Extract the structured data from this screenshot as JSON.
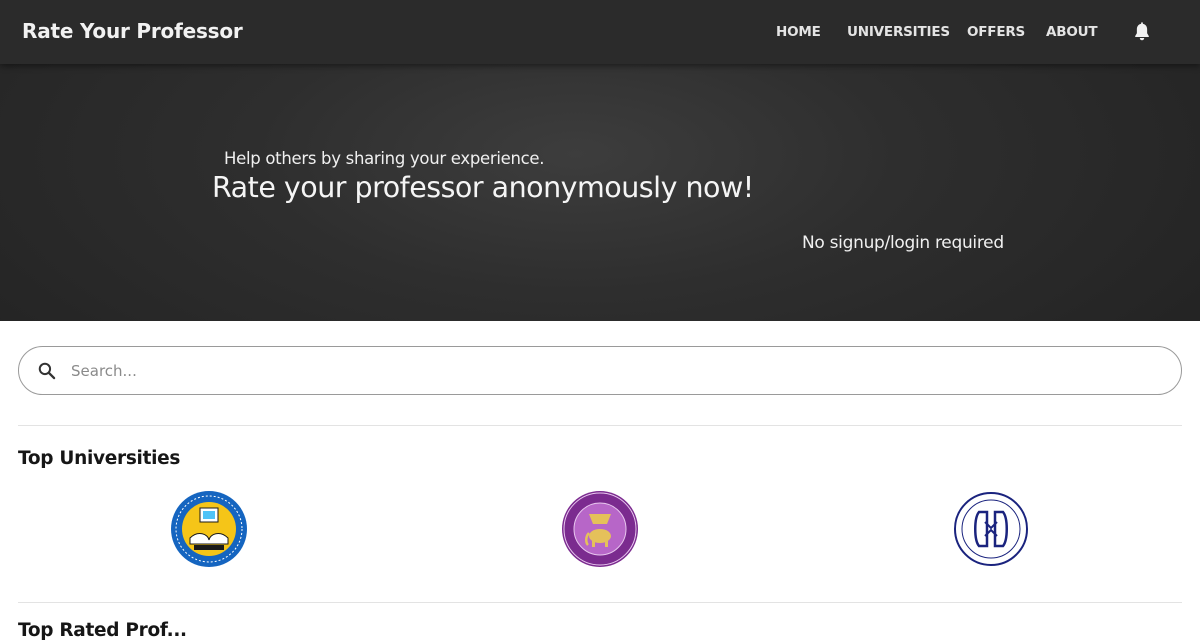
{
  "navbar": {
    "brand": "Rate Your Professor",
    "links": [
      {
        "label": "HOME"
      },
      {
        "label": "UNIVERSITIES"
      },
      {
        "label": "OFFERS"
      },
      {
        "label": "ABOUT"
      }
    ],
    "icons": {
      "notifications": "bell-icon"
    }
  },
  "hero": {
    "subtitle": "Help others by sharing your experience.",
    "title": "Rate your professor anonymously now!",
    "note": "No signup/login required"
  },
  "search": {
    "placeholder": "Search...",
    "value": "",
    "icon": "search-icon"
  },
  "top_universities": {
    "heading": "Top Universities",
    "logos": [
      {
        "icon": "university-seal-1",
        "ring": "#1565c0",
        "inner": "#f5c518"
      },
      {
        "icon": "university-seal-2",
        "ring": "#7b2b8f",
        "inner": "#b766c8"
      },
      {
        "icon": "university-seal-3",
        "ring": "#1a237e",
        "inner": "#ffffff"
      }
    ]
  },
  "next_section": {
    "heading": "Top Rated Prof..."
  },
  "colors": {
    "navbar_bg": "#2b2b2b",
    "hero_bg": "#2e2e2e",
    "text_light": "#f0f0f0"
  }
}
